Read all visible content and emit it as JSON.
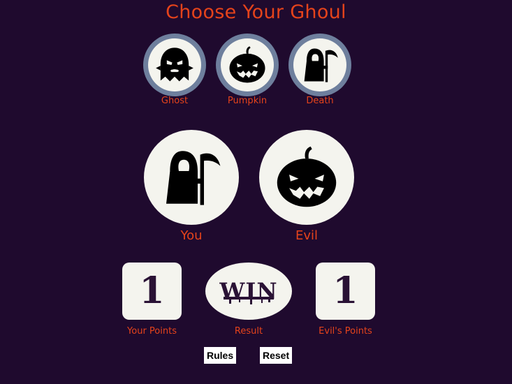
{
  "title": "Choose Your Ghoul",
  "choices": [
    {
      "label": "Ghost",
      "icon": "ghost-icon"
    },
    {
      "label": "Pumpkin",
      "icon": "pumpkin-icon"
    },
    {
      "label": "Death",
      "icon": "reaper-icon"
    }
  ],
  "players": {
    "you": {
      "label": "You",
      "icon": "reaper-icon"
    },
    "evil": {
      "label": "Evil",
      "icon": "pumpkin-icon"
    }
  },
  "scores": {
    "your_points_value": "1",
    "your_points_label": "Your Points",
    "result_value": "WIN",
    "result_label": "Result",
    "evil_points_value": "1",
    "evil_points_label": "Evil's Points"
  },
  "buttons": {
    "rules": "Rules",
    "reset": "Reset"
  },
  "colors": {
    "background": "#1f0a2e",
    "accent": "#e5431b",
    "ring": "#6e7f9d",
    "disc": "#f4f4ee"
  }
}
